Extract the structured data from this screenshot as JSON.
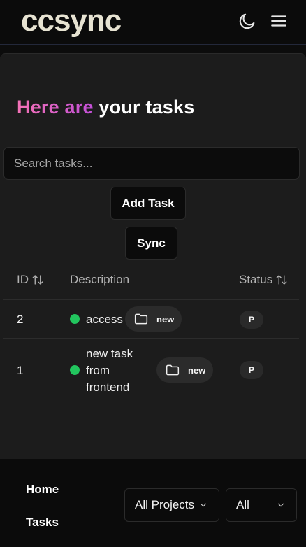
{
  "app": {
    "logo_text": "ccsync"
  },
  "header": {
    "theme_icon": "moon-icon",
    "menu_icon": "hamburger-menu-icon"
  },
  "heading": {
    "highlight": "Here are",
    "rest": "your tasks"
  },
  "search": {
    "placeholder": "Search tasks...",
    "value": ""
  },
  "actions": {
    "add_label": "Add Task",
    "sync_label": "Sync"
  },
  "table": {
    "columns": {
      "id": "ID",
      "description": "Description",
      "status": "Status"
    },
    "rows": [
      {
        "id": "2",
        "description": "access",
        "project": "new",
        "status": "P",
        "dot_color": "#22c55e"
      },
      {
        "id": "1",
        "description": "new task from frontend",
        "description_lines": [
          "new task",
          "from",
          "frontend"
        ],
        "project": "new",
        "status": "P",
        "dot_color": "#22c55e"
      }
    ]
  },
  "footer": {
    "links": [
      "Home",
      "Tasks"
    ],
    "project_filter": "All Projects",
    "status_filter": "All"
  },
  "colors": {
    "accent_pink": "#f472b6",
    "accent_purple": "#c14fd6",
    "status_green": "#22c55e"
  }
}
